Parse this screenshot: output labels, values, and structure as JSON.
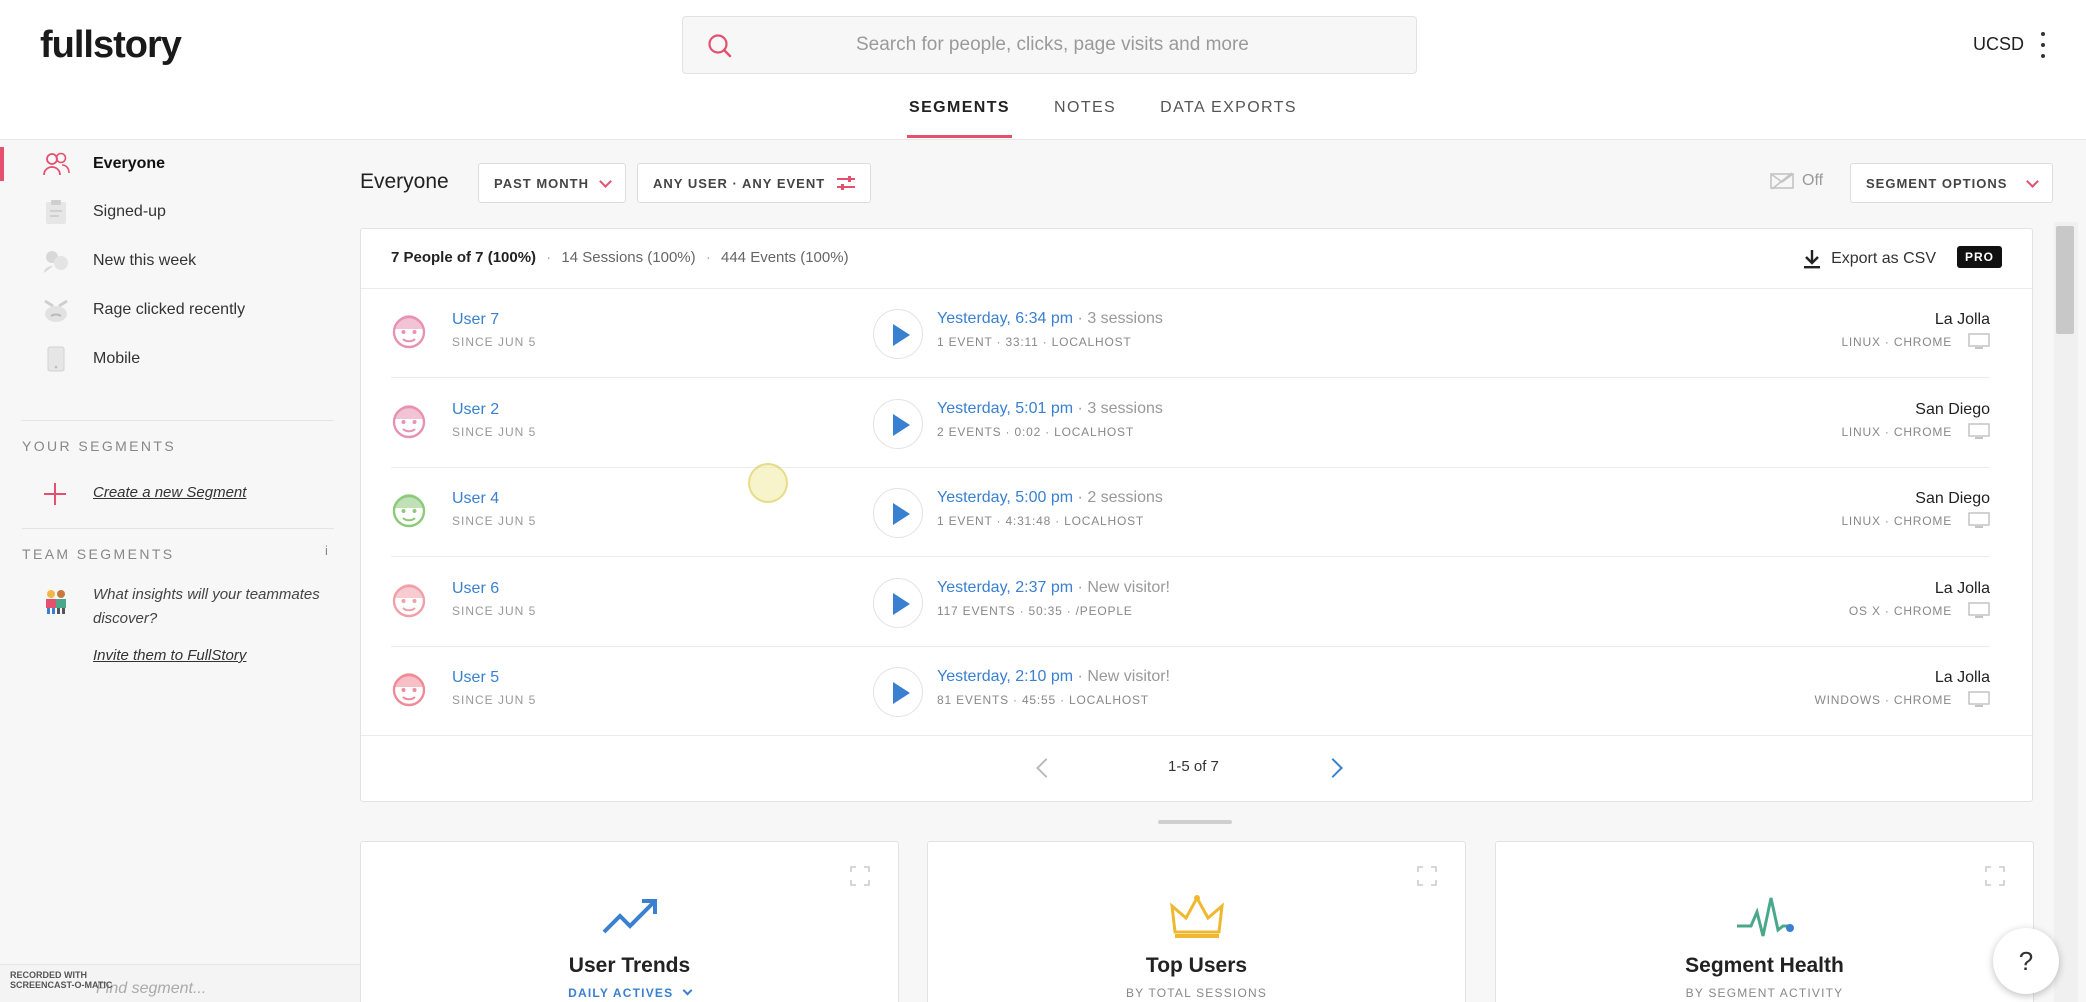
{
  "app": {
    "logo": "fullstory",
    "org": "UCSD"
  },
  "search": {
    "placeholder": "Search for people, clicks, page visits and more"
  },
  "tabs": [
    {
      "label": "SEGMENTS",
      "active": true
    },
    {
      "label": "NOTES",
      "active": false
    },
    {
      "label": "DATA EXPORTS",
      "active": false
    }
  ],
  "sidebar": {
    "items": [
      {
        "label": "Everyone",
        "icon": "people-icon",
        "active": true
      },
      {
        "label": "Signed-up",
        "icon": "clipboard-icon",
        "active": false
      },
      {
        "label": "New this week",
        "icon": "new-users-icon",
        "active": false
      },
      {
        "label": "Rage clicked recently",
        "icon": "angry-face-icon",
        "active": false
      },
      {
        "label": "Mobile",
        "icon": "mobile-icon",
        "active": false
      }
    ],
    "your_segments_heading": "YOUR SEGMENTS",
    "create_segment": "Create a new Segment",
    "team_segments_heading": "TEAM SEGMENTS",
    "team_info": "i",
    "team_prompt": "What insights will your teammates discover?",
    "invite_link": "Invite them to FullStory",
    "bottom_input_placeholder": "Find segment..."
  },
  "segment": {
    "title": "Everyone",
    "time_filter": "PAST MONTH",
    "event_filter": "ANY USER · ANY EVENT",
    "alerts_label": "Off",
    "options_label": "SEGMENT OPTIONS"
  },
  "summary": {
    "people": "7 People of 7 (100%)",
    "sessions": "14 Sessions (100%)",
    "events": "444 Events (100%)",
    "separator": "·",
    "export_label": "Export as CSV",
    "pro_badge": "PRO"
  },
  "users": [
    {
      "name": "User 7",
      "since": "SINCE JUN 5",
      "when": "Yesterday, 6:34 pm",
      "sessions": " · 3 sessions",
      "detail": "1 EVENT · 33:11 · LOCALHOST",
      "location": "La Jolla",
      "platform": "LINUX · CHROME",
      "avatar_color": "#e892b2"
    },
    {
      "name": "User 2",
      "since": "SINCE JUN 5",
      "when": "Yesterday, 5:01 pm",
      "sessions": " · 3 sessions",
      "detail": "2 EVENTS · 0:02 · LOCALHOST",
      "location": "San Diego",
      "platform": "LINUX · CHROME",
      "avatar_color": "#e892b2"
    },
    {
      "name": "User 4",
      "since": "SINCE JUN 5",
      "when": "Yesterday, 5:00 pm",
      "sessions": " · 2 sessions",
      "detail": "1 EVENT · 4:31:48 · LOCALHOST",
      "location": "San Diego",
      "platform": "LINUX · CHROME",
      "avatar_color": "#8cc97a"
    },
    {
      "name": "User 6",
      "since": "SINCE JUN 5",
      "when": "Yesterday, 2:37 pm",
      "sessions": " · New visitor!",
      "detail": "117 EVENTS · 50:35 · /PEOPLE",
      "location": "La Jolla",
      "platform": "OS X · CHROME",
      "avatar_color": "#f0a0a8"
    },
    {
      "name": "User 5",
      "since": "SINCE JUN 5",
      "when": "Yesterday, 2:10 pm",
      "sessions": " · New visitor!",
      "detail": "81 EVENTS · 45:55 · LOCALHOST",
      "location": "La Jolla",
      "platform": "WINDOWS · CHROME",
      "avatar_color": "#f08a98"
    }
  ],
  "pagination": {
    "label": "1-5 of 7"
  },
  "widgets": [
    {
      "title": "User Trends",
      "subtitle": "DAILY ACTIVES",
      "icon": "trend-up-icon",
      "dropdown": true
    },
    {
      "title": "Top Users",
      "subtitle": "BY TOTAL SESSIONS",
      "icon": "crown-icon",
      "dropdown": false
    },
    {
      "title": "Segment Health",
      "subtitle": "BY SEGMENT ACTIVITY",
      "icon": "pulse-icon",
      "dropdown": false
    }
  ],
  "help": {
    "label": "?"
  },
  "watermark": {
    "line1": "RECORDED WITH",
    "line2": "SCREENCAST-O-MATIC"
  },
  "colors": {
    "accent": "#e4506e",
    "link": "#3a80d0",
    "trend": "#3a80d0",
    "crown": "#f0b830",
    "pulse": "#4aa88a"
  }
}
